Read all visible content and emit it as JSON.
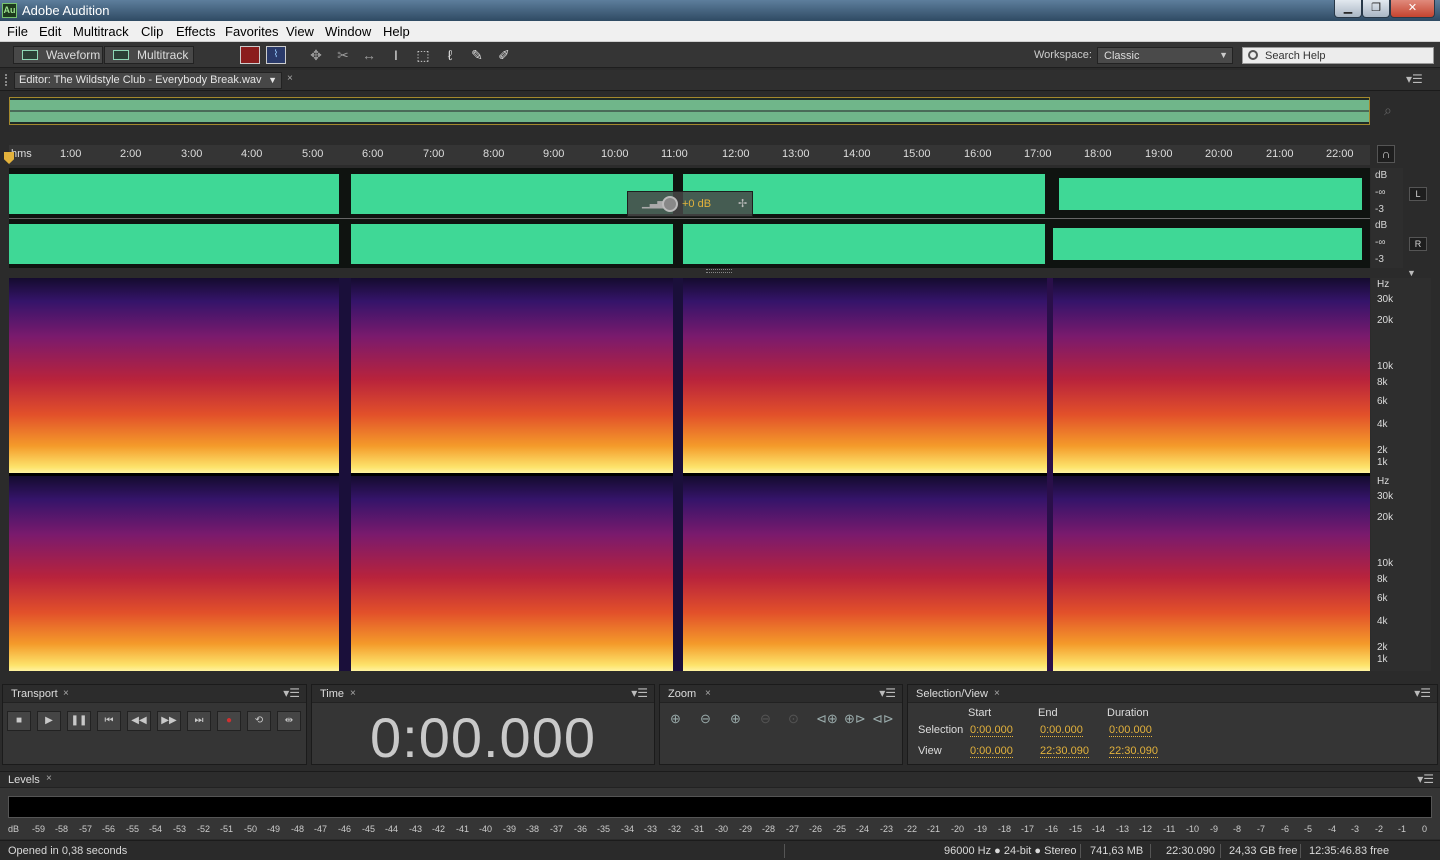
{
  "window": {
    "app_name": "Adobe Audition",
    "icon_text": "Au"
  },
  "menu": [
    "File",
    "Edit",
    "Multitrack",
    "Clip",
    "Effects",
    "Favorites",
    "View",
    "Window",
    "Help"
  ],
  "toolbar": {
    "waveform_label": "Waveform",
    "multitrack_label": "Multitrack",
    "workspace_label": "Workspace:",
    "workspace_value": "Classic",
    "search_placeholder": "Search Help"
  },
  "editor": {
    "tab_label": "Editor: The Wildstyle Club - Everybody Break.wav"
  },
  "ruler": {
    "unit": "hms",
    "ticks": [
      "1:00",
      "2:00",
      "3:00",
      "4:00",
      "5:00",
      "6:00",
      "7:00",
      "8:00",
      "9:00",
      "10:00",
      "11:00",
      "12:00",
      "13:00",
      "14:00",
      "15:00",
      "16:00",
      "17:00",
      "18:00",
      "19:00",
      "20:00",
      "21:00",
      "22:00"
    ]
  },
  "waveform": {
    "db_label": "dB",
    "neg_inf": "-∞",
    "minus3": "-3",
    "left": "L",
    "right": "R",
    "hud_value": "+0 dB"
  },
  "spectral": {
    "hz_label": "Hz",
    "ticks": [
      "30k",
      "20k",
      "10k",
      "8k",
      "6k",
      "4k",
      "2k",
      "1k"
    ]
  },
  "transport": {
    "title": "Transport"
  },
  "time": {
    "title": "Time",
    "value": "0:00.000"
  },
  "zoom": {
    "title": "Zoom"
  },
  "selection": {
    "title": "Selection/View",
    "headers": [
      "Start",
      "End",
      "Duration"
    ],
    "rows": [
      {
        "label": "Selection",
        "start": "0:00.000",
        "end": "0:00.000",
        "duration": "0:00.000"
      },
      {
        "label": "View",
        "start": "0:00.000",
        "end": "22:30.090",
        "duration": "22:30.090"
      }
    ]
  },
  "levels": {
    "title": "Levels",
    "scale": [
      "dB",
      "-59",
      "-58",
      "-57",
      "-56",
      "-55",
      "-54",
      "-53",
      "-52",
      "-51",
      "-50",
      "-49",
      "-48",
      "-47",
      "-46",
      "-45",
      "-44",
      "-43",
      "-42",
      "-41",
      "-40",
      "-39",
      "-38",
      "-37",
      "-36",
      "-35",
      "-34",
      "-33",
      "-32",
      "-31",
      "-30",
      "-29",
      "-28",
      "-27",
      "-26",
      "-25",
      "-24",
      "-23",
      "-22",
      "-21",
      "-20",
      "-19",
      "-18",
      "-17",
      "-16",
      "-15",
      "-14",
      "-13",
      "-12",
      "-11",
      "-10",
      "-9",
      "-8",
      "-7",
      "-6",
      "-5",
      "-4",
      "-3",
      "-2",
      "-1",
      "0"
    ]
  },
  "status": {
    "message": "Opened in 0,38 seconds",
    "format": "96000 Hz ● 24-bit ● Stereo",
    "size": "741,63 MB",
    "duration": "22:30.090",
    "free": "24,33 GB free",
    "time_free": "12:35:46.83 free"
  },
  "colors": {
    "wave": "#3fd896",
    "accent": "#e3b23c"
  }
}
